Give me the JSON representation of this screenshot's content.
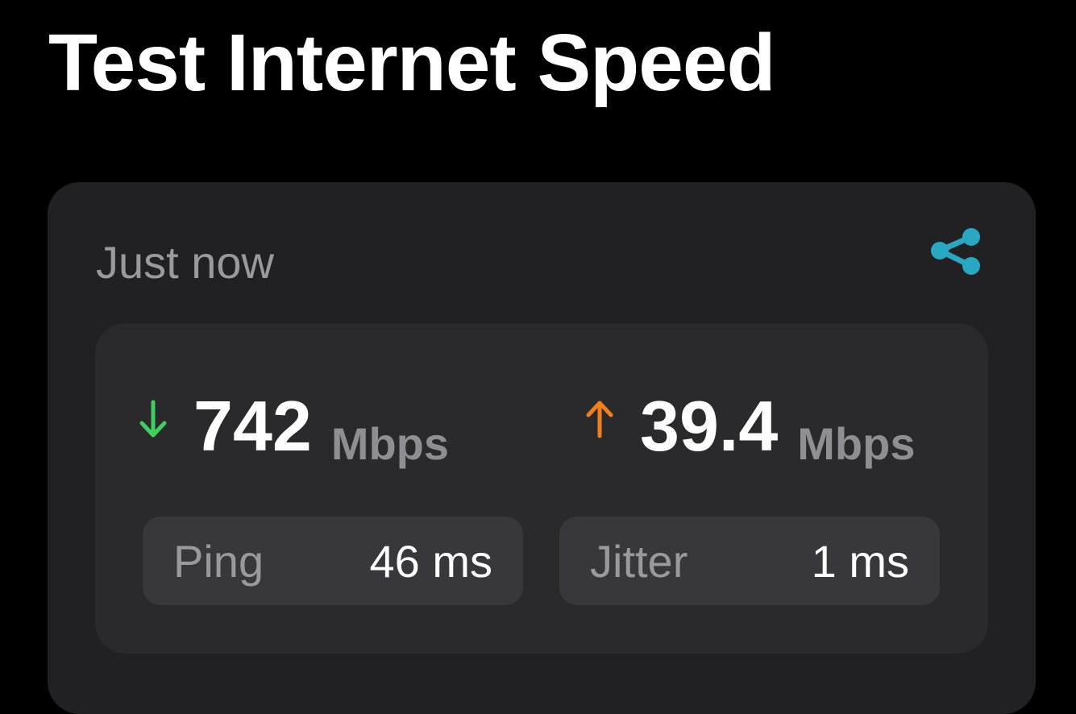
{
  "header": {
    "title": "Test Internet Speed"
  },
  "result": {
    "timestamp": "Just now",
    "share_icon": "share-icon",
    "download": {
      "icon": "arrow-down-icon",
      "value": "742",
      "unit": "Mbps",
      "color": "#3ecf5e"
    },
    "upload": {
      "icon": "arrow-up-icon",
      "value": "39.4",
      "unit": "Mbps",
      "color": "#f0801e"
    },
    "ping": {
      "label": "Ping",
      "value": "46 ms"
    },
    "jitter": {
      "label": "Jitter",
      "value": "1 ms"
    }
  },
  "colors": {
    "accent": "#29a8c4",
    "background": "#000000",
    "card": "#212123",
    "panel": "#2a2a2d",
    "chip": "#38383c"
  }
}
